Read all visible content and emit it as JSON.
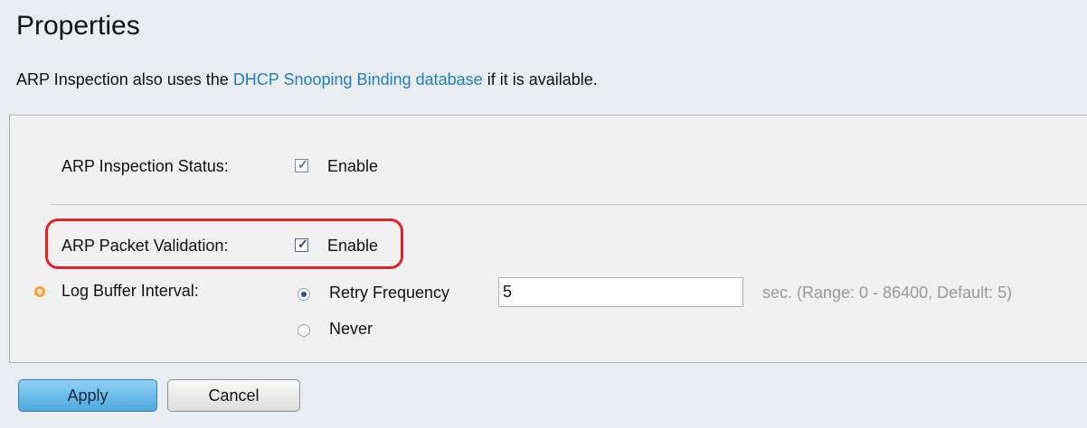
{
  "page": {
    "title": "Properties",
    "intro_prefix": "ARP Inspection also uses the ",
    "intro_link": "DHCP Snooping Binding database",
    "intro_suffix": " if it is available."
  },
  "form": {
    "arp_inspection_status": {
      "label": "ARP Inspection Status:",
      "checked": true,
      "checkbox_label": "Enable"
    },
    "arp_packet_validation": {
      "label": "ARP Packet Validation:",
      "checked": true,
      "checkbox_label": "Enable"
    },
    "log_buffer_interval": {
      "label": "Log Buffer Interval:",
      "options": [
        {
          "label": "Retry Frequency",
          "selected": true
        },
        {
          "label": "Never",
          "selected": false
        }
      ],
      "value": "5",
      "hint": "sec. (Range: 0 - 86400, Default: 5)"
    }
  },
  "buttons": {
    "apply": "Apply",
    "cancel": "Cancel"
  },
  "colors": {
    "link": "#1f7fc1",
    "highlight": "#e0242e",
    "required_indicator": "#f4a340",
    "apply_button": "#4ea8df"
  },
  "icons": {
    "checkmark": "check-icon",
    "required": "required-indicator-icon"
  }
}
